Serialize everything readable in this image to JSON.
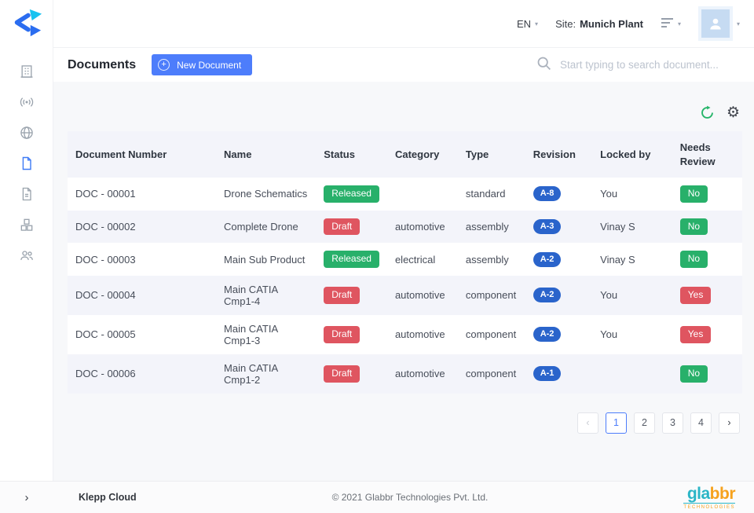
{
  "colors": {
    "accent": "#4d7dfb",
    "green": "#28b06a",
    "red": "#df5560",
    "revision_blue": "#2a64cb",
    "logo_cyan": "#18c2f0",
    "logo_blue": "#2b6df0",
    "footer_teal": "#2ab5c6",
    "footer_orange": "#f6a21e"
  },
  "topbar": {
    "language": "EN",
    "site_label": "Site:",
    "site_value": "Munich Plant",
    "caret": "▾",
    "icons": [
      "menu-icon",
      "user-avatar-icon"
    ]
  },
  "sidebar": {
    "icons": [
      "building-icon",
      "broadcast-icon",
      "globe-icon",
      "documents-icon",
      "report-icon",
      "inventory-icon",
      "team-icon"
    ],
    "active_item": "documents-icon",
    "collapse_icon": "chevron-right-icon",
    "collapse_glyph": "›"
  },
  "subheader": {
    "title": "Documents",
    "new_document_label": "New Document",
    "plus_glyph": "+",
    "search_placeholder": "Start typing to search document...",
    "search_icon": "search-icon"
  },
  "toolbar": {
    "icons": [
      "refresh-icon",
      "gear-icon"
    ],
    "gear_glyph": "⚙"
  },
  "table": {
    "headers": [
      "Document Number",
      "Name",
      "Status",
      "Category",
      "Type",
      "Revision",
      "Locked by",
      "Needs Review"
    ],
    "rows": [
      {
        "number": "DOC - 00001",
        "name": "Drone Schematics",
        "status": "Released",
        "status_color": "green",
        "category": "",
        "type": "standard",
        "revision": "A-8",
        "locked_by": "You",
        "needs_review": "No",
        "review_color": "green"
      },
      {
        "number": "DOC - 00002",
        "name": "Complete Drone",
        "status": "Draft",
        "status_color": "red",
        "category": "automotive",
        "type": "assembly",
        "revision": "A-3",
        "locked_by": "Vinay S",
        "needs_review": "No",
        "review_color": "green"
      },
      {
        "number": "DOC - 00003",
        "name": "Main Sub Product",
        "status": "Released",
        "status_color": "green",
        "category": "electrical",
        "type": "assembly",
        "revision": "A-2",
        "locked_by": "Vinay S",
        "needs_review": "No",
        "review_color": "green"
      },
      {
        "number": "DOC - 00004",
        "name": "Main CATIA Cmp1-4",
        "status": "Draft",
        "status_color": "red",
        "category": "automotive",
        "type": "component",
        "revision": "A-2",
        "locked_by": "You",
        "needs_review": "Yes",
        "review_color": "red"
      },
      {
        "number": "DOC - 00005",
        "name": "Main CATIA Cmp1-3",
        "status": "Draft",
        "status_color": "red",
        "category": "automotive",
        "type": "component",
        "revision": "A-2",
        "locked_by": "You",
        "needs_review": "Yes",
        "review_color": "red"
      },
      {
        "number": "DOC - 00006",
        "name": "Main CATIA Cmp1-2",
        "status": "Draft",
        "status_color": "red",
        "category": "automotive",
        "type": "component",
        "revision": "A-1",
        "locked_by": "",
        "needs_review": "No",
        "review_color": "green"
      }
    ]
  },
  "pagination": {
    "prev_glyph": "‹",
    "next_glyph": "›",
    "pages": [
      "1",
      "2",
      "3",
      "4"
    ],
    "active_page": "1"
  },
  "footer": {
    "app_name": "Klepp Cloud",
    "copyright": "© 2021 Glabbr Technologies Pvt. Ltd.",
    "logo_primary": "gla",
    "logo_secondary": "bbr",
    "logo_sub": "TECHNOLOGIES"
  }
}
